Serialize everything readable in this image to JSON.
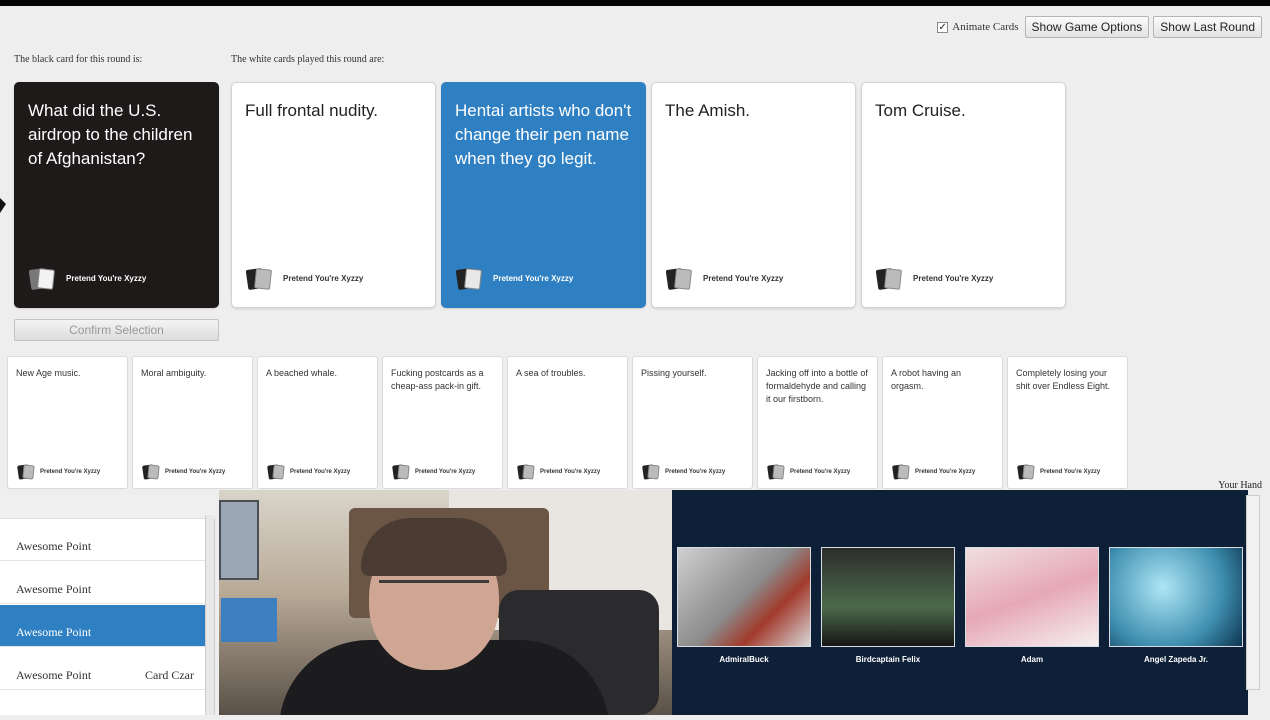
{
  "colors": {
    "black_card": "#1e1a19",
    "selected_card": "#2f80c3",
    "player_panel": "#0e1f38"
  },
  "controls": {
    "animate_checked": "✓",
    "animate_label": "Animate Cards",
    "show_game_options": "Show Game Options",
    "show_last_round": "Show Last Round"
  },
  "round": {
    "black_caption": "The black card for this round is:",
    "white_caption": "The white cards played this round are:",
    "black_card": {
      "text": "What did the U.S. airdrop to the children of Afghanistan?",
      "brand": "Pretend You're Xyzzy"
    },
    "white_cards": [
      {
        "text": "Full frontal nudity.",
        "brand": "Pretend You're Xyzzy"
      },
      {
        "text": "Hentai artists who don't change their pen name when they go legit.",
        "brand": "Pretend You're Xyzzy"
      },
      {
        "text": "The Amish.",
        "brand": "Pretend You're Xyzzy"
      },
      {
        "text": "Tom Cruise.",
        "brand": "Pretend You're Xyzzy"
      }
    ],
    "confirm": "Confirm Selection"
  },
  "hand": {
    "label": "Your Hand",
    "cards": [
      {
        "text": "New Age music.",
        "brand": "Pretend You're Xyzzy"
      },
      {
        "text": "Moral ambiguity.",
        "brand": "Pretend You're Xyzzy"
      },
      {
        "text": "A beached whale.",
        "brand": "Pretend You're Xyzzy"
      },
      {
        "text": "Fucking postcards as a cheap-ass pack-in gift.",
        "brand": "Pretend You're Xyzzy"
      },
      {
        "text": "A sea of troubles.",
        "brand": "Pretend You're Xyzzy"
      },
      {
        "text": "Pissing yourself.",
        "brand": "Pretend You're Xyzzy"
      },
      {
        "text": "Jacking off into a bottle of formaldehyde and calling it our firstborn.",
        "brand": "Pretend You're Xyzzy"
      },
      {
        "text": "A robot having an orgasm.",
        "brand": "Pretend You're Xyzzy"
      },
      {
        "text": "Completely losing your shit over Endless Eight.",
        "brand": "Pretend You're Xyzzy"
      }
    ]
  },
  "scoreboard": {
    "rows": [
      {
        "points": "Awesome Point",
        "status": ""
      },
      {
        "points": "Awesome Point",
        "status": ""
      },
      {
        "points": "Awesome Point",
        "status": ""
      },
      {
        "points": "Awesome Point",
        "status": "Card Czar"
      }
    ]
  },
  "players": [
    {
      "name": "AdmiralBuck"
    },
    {
      "name": "Birdcaptain Felix"
    },
    {
      "name": "Adam"
    },
    {
      "name": "Angel Zapeda Jr."
    }
  ]
}
